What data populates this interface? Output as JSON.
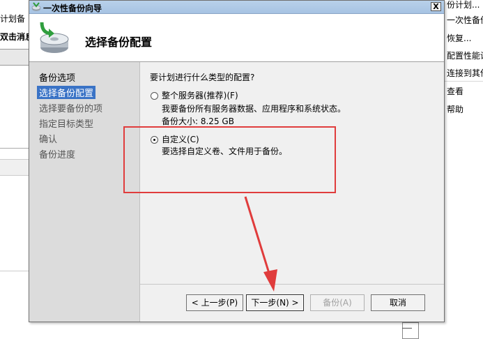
{
  "background_left": {
    "line1": "计划备",
    "line2": "双击消息"
  },
  "background_right": {
    "items": [
      "份计划...",
      "一次性备份",
      "恢复...",
      "配置性能设",
      "连接到其他",
      "查看",
      "帮助"
    ]
  },
  "dialog": {
    "title": "一次性备份向导",
    "close_glyph": "X",
    "header_title": "选择备份配置",
    "nav": {
      "items": [
        {
          "label": "备份选项",
          "state": "normal"
        },
        {
          "label": "选择备份配置",
          "state": "selected"
        },
        {
          "label": "选择要备份的项",
          "state": "pending"
        },
        {
          "label": "指定目标类型",
          "state": "pending"
        },
        {
          "label": "确认",
          "state": "pending"
        },
        {
          "label": "备份进度",
          "state": "pending"
        }
      ]
    },
    "question": "要计划进行什么类型的配置?",
    "options": [
      {
        "label": "整个服务器(推荐)(F)",
        "description": "我要备份所有服务器数据、应用程序和系统状态。",
        "size": "备份大小: 8.25 GB",
        "selected": false
      },
      {
        "label": "自定义(C)",
        "description": "要选择自定义卷、文件用于备份。",
        "selected": true
      }
    ],
    "buttons": {
      "back": "< 上一步(P)",
      "next": "下一步(N) >",
      "backup": "备份(A)",
      "cancel": "取消"
    }
  },
  "colors": {
    "nav_selected": "#3a73c6",
    "annotation": "#e03c3c"
  }
}
